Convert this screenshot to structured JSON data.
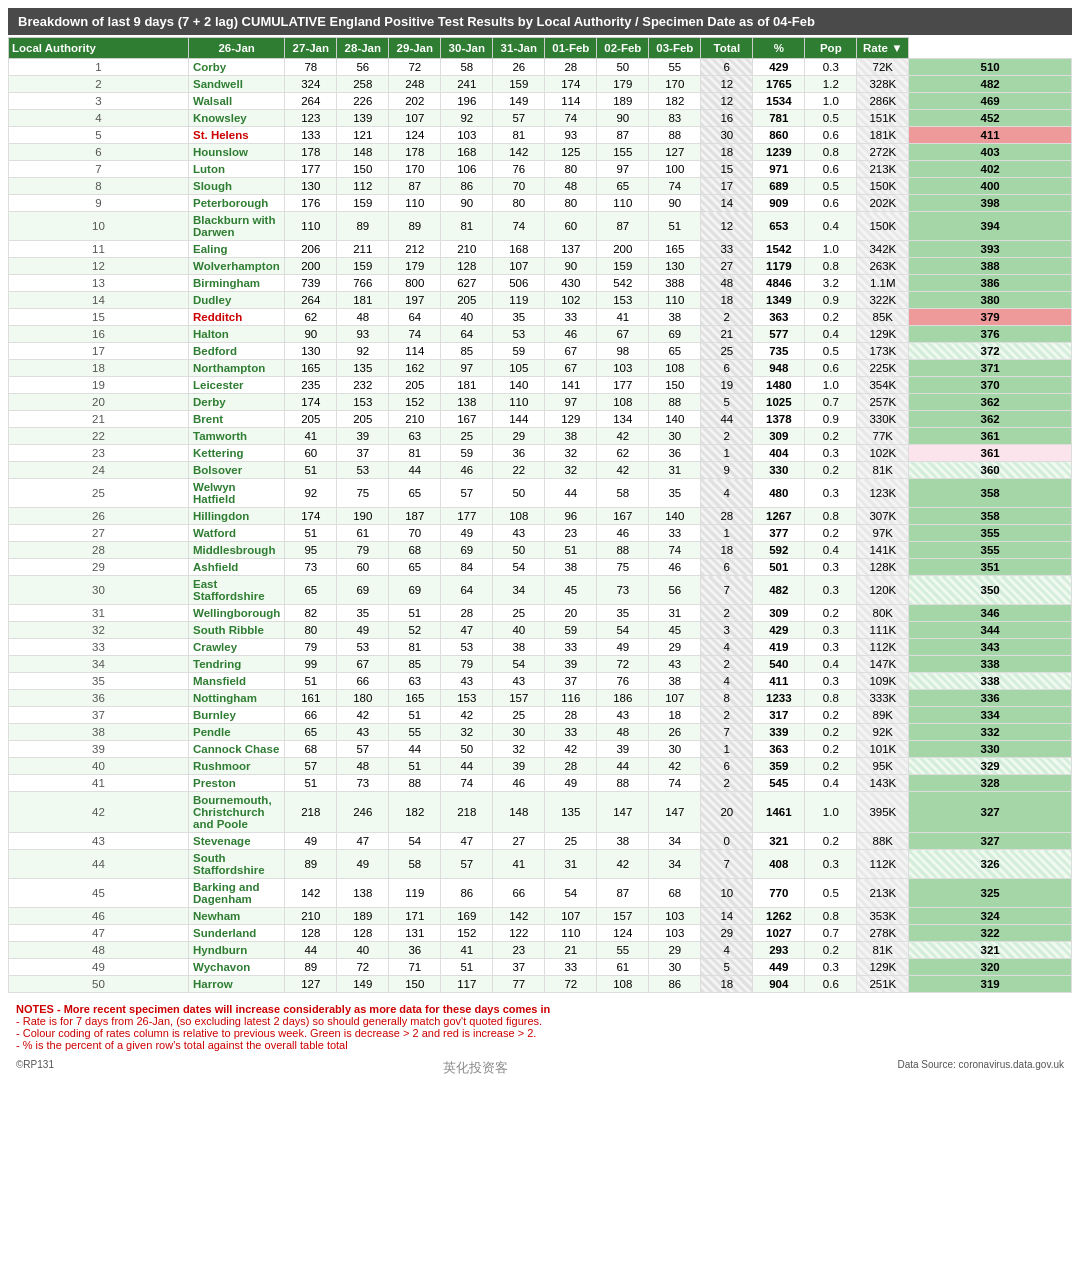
{
  "title": {
    "prefix": "Breakdown of last 9 days (7 + 2 lag)  CUMULATIVE England Positive Test Results by Local Authority / Specimen Date as of 04-Feb"
  },
  "headers": [
    "Local Authority",
    "26-Jan",
    "27-Jan",
    "28-Jan",
    "29-Jan",
    "30-Jan",
    "31-Jan",
    "01-Feb",
    "02-Feb",
    "03-Feb",
    "Total",
    "%",
    "Pop",
    "Rate ▼"
  ],
  "rows": [
    [
      1,
      "Corby",
      78,
      56,
      72,
      58,
      26,
      28,
      50,
      55,
      6,
      429,
      "0.3",
      "72K",
      510,
      "green"
    ],
    [
      2,
      "Sandwell",
      324,
      258,
      248,
      241,
      159,
      174,
      179,
      170,
      12,
      1765,
      "1.2",
      "328K",
      482,
      "green"
    ],
    [
      3,
      "Walsall",
      264,
      226,
      202,
      196,
      149,
      114,
      189,
      182,
      12,
      1534,
      "1.0",
      "286K",
      469,
      "green"
    ],
    [
      4,
      "Knowsley",
      123,
      139,
      107,
      92,
      57,
      74,
      90,
      83,
      16,
      781,
      "0.5",
      "151K",
      452,
      "green"
    ],
    [
      5,
      "St. Helens",
      133,
      121,
      124,
      103,
      81,
      93,
      87,
      88,
      30,
      860,
      "0.6",
      "181K",
      411,
      "red"
    ],
    [
      6,
      "Hounslow",
      178,
      148,
      178,
      168,
      142,
      125,
      155,
      127,
      18,
      1239,
      "0.8",
      "272K",
      403,
      "green"
    ],
    [
      7,
      "Luton",
      177,
      150,
      170,
      106,
      76,
      80,
      97,
      100,
      15,
      971,
      "0.6",
      "213K",
      402,
      "green"
    ],
    [
      8,
      "Slough",
      130,
      112,
      87,
      86,
      70,
      48,
      65,
      74,
      17,
      689,
      "0.5",
      "150K",
      400,
      "green"
    ],
    [
      9,
      "Peterborough",
      176,
      159,
      110,
      90,
      80,
      80,
      110,
      90,
      14,
      909,
      "0.6",
      "202K",
      398,
      "green"
    ],
    [
      10,
      "Blackburn with Darwen",
      110,
      89,
      89,
      81,
      74,
      60,
      87,
      51,
      12,
      653,
      "0.4",
      "150K",
      394,
      "green"
    ],
    [
      11,
      "Ealing",
      206,
      211,
      212,
      210,
      168,
      137,
      200,
      165,
      33,
      1542,
      "1.0",
      "342K",
      393,
      "green"
    ],
    [
      12,
      "Wolverhampton",
      200,
      159,
      179,
      128,
      107,
      90,
      159,
      130,
      27,
      1179,
      "0.8",
      "263K",
      388,
      "green"
    ],
    [
      13,
      "Birmingham",
      739,
      766,
      800,
      627,
      506,
      430,
      542,
      388,
      48,
      4846,
      "3.2",
      "1.1M",
      386,
      "green"
    ],
    [
      14,
      "Dudley",
      264,
      181,
      197,
      205,
      119,
      102,
      153,
      110,
      18,
      1349,
      "0.9",
      "322K",
      380,
      "green"
    ],
    [
      15,
      "Redditch",
      62,
      48,
      64,
      40,
      35,
      33,
      41,
      38,
      2,
      363,
      "0.2",
      "85K",
      379,
      "red"
    ],
    [
      16,
      "Halton",
      90,
      93,
      74,
      64,
      53,
      46,
      67,
      69,
      21,
      577,
      "0.4",
      "129K",
      376,
      "green"
    ],
    [
      17,
      "Bedford",
      130,
      92,
      114,
      85,
      59,
      67,
      98,
      65,
      25,
      735,
      "0.5",
      "173K",
      372,
      "hatched"
    ],
    [
      18,
      "Northampton",
      165,
      135,
      162,
      97,
      105,
      67,
      103,
      108,
      6,
      948,
      "0.6",
      "225K",
      371,
      "green"
    ],
    [
      19,
      "Leicester",
      235,
      232,
      205,
      181,
      140,
      141,
      177,
      150,
      19,
      1480,
      "1.0",
      "354K",
      370,
      "green"
    ],
    [
      20,
      "Derby",
      174,
      153,
      152,
      138,
      110,
      97,
      108,
      88,
      5,
      1025,
      "0.7",
      "257K",
      362,
      "green"
    ],
    [
      21,
      "Brent",
      205,
      205,
      210,
      167,
      144,
      129,
      134,
      140,
      44,
      1378,
      "0.9",
      "330K",
      362,
      "green"
    ],
    [
      22,
      "Tamworth",
      41,
      39,
      63,
      25,
      29,
      38,
      42,
      30,
      2,
      309,
      "0.2",
      "77K",
      361,
      "green"
    ],
    [
      23,
      "Kettering",
      60,
      37,
      81,
      59,
      36,
      32,
      62,
      36,
      1,
      404,
      "0.3",
      "102K",
      361,
      "pink"
    ],
    [
      24,
      "Bolsover",
      51,
      53,
      44,
      46,
      22,
      32,
      42,
      31,
      9,
      330,
      "0.2",
      "81K",
      360,
      "hatched"
    ],
    [
      25,
      "Welwyn Hatfield",
      92,
      75,
      65,
      57,
      50,
      44,
      58,
      35,
      4,
      480,
      "0.3",
      "123K",
      358,
      "green"
    ],
    [
      26,
      "Hillingdon",
      174,
      190,
      187,
      177,
      108,
      96,
      167,
      140,
      28,
      1267,
      "0.8",
      "307K",
      358,
      "green"
    ],
    [
      27,
      "Watford",
      51,
      61,
      70,
      49,
      43,
      23,
      46,
      33,
      1,
      377,
      "0.2",
      "97K",
      355,
      "green"
    ],
    [
      28,
      "Middlesbrough",
      95,
      79,
      68,
      69,
      50,
      51,
      88,
      74,
      18,
      592,
      "0.4",
      "141K",
      355,
      "green"
    ],
    [
      29,
      "Ashfield",
      73,
      60,
      65,
      84,
      54,
      38,
      75,
      46,
      6,
      501,
      "0.3",
      "128K",
      351,
      "green"
    ],
    [
      30,
      "East Staffordshire",
      65,
      69,
      69,
      64,
      34,
      45,
      73,
      56,
      7,
      482,
      "0.3",
      "120K",
      350,
      "hatched"
    ],
    [
      31,
      "Wellingborough",
      82,
      35,
      51,
      28,
      25,
      20,
      35,
      31,
      2,
      309,
      "0.2",
      "80K",
      346,
      "green"
    ],
    [
      32,
      "South Ribble",
      80,
      49,
      52,
      47,
      40,
      59,
      54,
      45,
      3,
      429,
      "0.3",
      "111K",
      344,
      "green"
    ],
    [
      33,
      "Crawley",
      79,
      53,
      81,
      53,
      38,
      33,
      49,
      29,
      4,
      419,
      "0.3",
      "112K",
      343,
      "green"
    ],
    [
      34,
      "Tendring",
      99,
      67,
      85,
      79,
      54,
      39,
      72,
      43,
      2,
      540,
      "0.4",
      "147K",
      338,
      "green"
    ],
    [
      35,
      "Mansfield",
      51,
      66,
      63,
      43,
      43,
      37,
      76,
      38,
      4,
      411,
      "0.3",
      "109K",
      338,
      "hatched"
    ],
    [
      36,
      "Nottingham",
      161,
      180,
      165,
      153,
      157,
      116,
      186,
      107,
      8,
      1233,
      "0.8",
      "333K",
      336,
      "green"
    ],
    [
      37,
      "Burnley",
      66,
      42,
      51,
      42,
      25,
      28,
      43,
      18,
      2,
      317,
      "0.2",
      "89K",
      334,
      "green"
    ],
    [
      38,
      "Pendle",
      65,
      43,
      55,
      32,
      30,
      33,
      48,
      26,
      7,
      339,
      "0.2",
      "92K",
      332,
      "green"
    ],
    [
      39,
      "Cannock Chase",
      68,
      57,
      44,
      50,
      32,
      42,
      39,
      30,
      1,
      363,
      "0.2",
      "101K",
      330,
      "green"
    ],
    [
      40,
      "Rushmoor",
      57,
      48,
      51,
      44,
      39,
      28,
      44,
      42,
      6,
      359,
      "0.2",
      "95K",
      329,
      "hatched"
    ],
    [
      41,
      "Preston",
      51,
      73,
      88,
      74,
      46,
      49,
      88,
      74,
      2,
      545,
      "0.4",
      "143K",
      328,
      "green"
    ],
    [
      42,
      "Bournemouth, Christchurch and Poole",
      218,
      246,
      182,
      218,
      148,
      135,
      147,
      147,
      20,
      1461,
      "1.0",
      "395K",
      327,
      "green"
    ],
    [
      43,
      "Stevenage",
      49,
      47,
      54,
      47,
      27,
      25,
      38,
      34,
      0,
      321,
      "0.2",
      "88K",
      327,
      "green"
    ],
    [
      44,
      "South Staffordshire",
      89,
      49,
      58,
      57,
      41,
      31,
      42,
      34,
      7,
      408,
      "0.3",
      "112K",
      326,
      "hatched"
    ],
    [
      45,
      "Barking and Dagenham",
      142,
      138,
      119,
      86,
      66,
      54,
      87,
      68,
      10,
      770,
      "0.5",
      "213K",
      325,
      "green"
    ],
    [
      46,
      "Newham",
      210,
      189,
      171,
      169,
      142,
      107,
      157,
      103,
      14,
      1262,
      "0.8",
      "353K",
      324,
      "green"
    ],
    [
      47,
      "Sunderland",
      128,
      128,
      131,
      152,
      122,
      110,
      124,
      103,
      29,
      1027,
      "0.7",
      "278K",
      322,
      "green"
    ],
    [
      48,
      "Hyndburn",
      44,
      40,
      36,
      41,
      23,
      21,
      55,
      29,
      4,
      293,
      "0.2",
      "81K",
      321,
      "hatched"
    ],
    [
      49,
      "Wychavon",
      89,
      72,
      71,
      51,
      37,
      33,
      61,
      30,
      5,
      449,
      "0.3",
      "129K",
      320,
      "green"
    ],
    [
      50,
      "Harrow",
      127,
      149,
      150,
      117,
      77,
      72,
      108,
      86,
      18,
      904,
      "0.6",
      "251K",
      319,
      "green"
    ]
  ],
  "notes": [
    "NOTES  - More recent specimen dates will increase considerably as more data for these days comes in",
    "- Rate is for 7 days from 26-Jan, (so excluding latest 2 days) so should generally match gov't quoted figures.",
    "- Colour coding of rates column is relative to previous week. Green is decrease > 2 and red is increase > 2.",
    "- % is the percent of a given row's total against the overall table total"
  ],
  "footer_left": "©RP131",
  "footer_right": "Data Source: coronavirus.data.gov.uk",
  "watermark": "英化投资客"
}
